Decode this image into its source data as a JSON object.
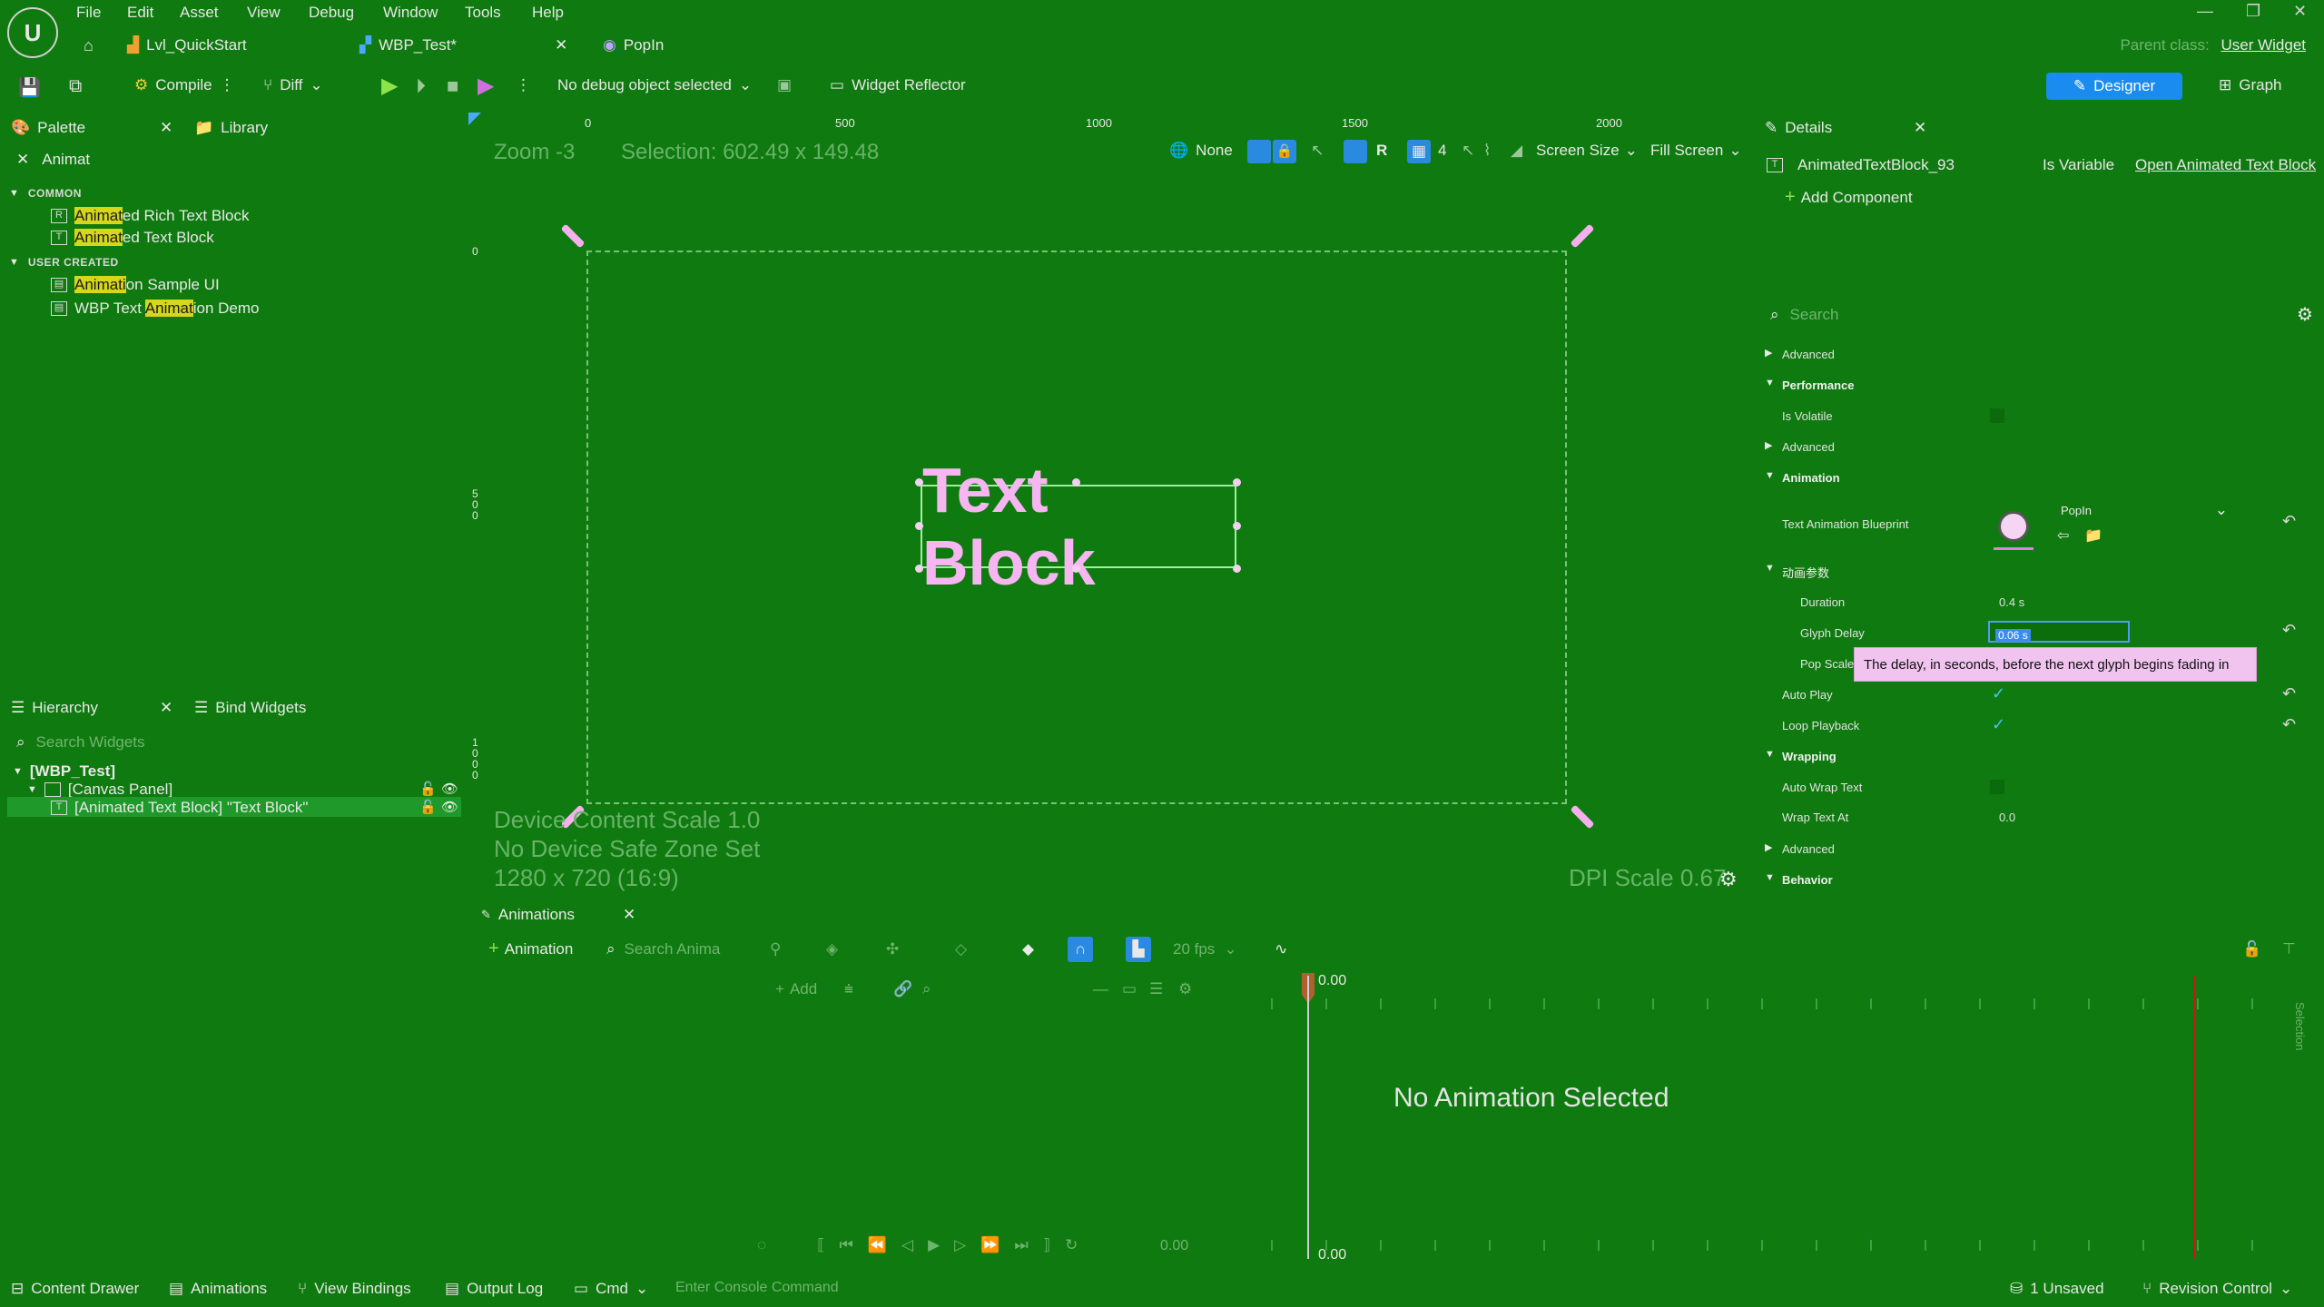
{
  "menu": [
    "File",
    "Edit",
    "Asset",
    "View",
    "Debug",
    "Window",
    "Tools",
    "Help"
  ],
  "logo": "U",
  "doc_tabs": [
    {
      "label": "Lvl_QuickStart",
      "icon": "level-icon"
    },
    {
      "label": "WBP_Test*",
      "icon": "widget-blueprint-icon"
    },
    {
      "label": "PopIn",
      "icon": "animation-blueprint-icon"
    }
  ],
  "parent_class": {
    "label": "Parent class:",
    "value": "User Widget"
  },
  "toolbar": {
    "compile": "Compile",
    "diff": "Diff",
    "debug_object": "No debug object selected",
    "widget_reflector": "Widget Reflector",
    "designer": "Designer",
    "graph": "Graph"
  },
  "palette": {
    "tab": "Palette",
    "library_tab": "Library",
    "search": "Animat",
    "categories": [
      {
        "name": "COMMON",
        "items": [
          {
            "hl": "Animat",
            "rest": "ed Rich Text Block"
          },
          {
            "hl": "Animat",
            "rest": "ed Text Block"
          }
        ]
      },
      {
        "name": "USER CREATED",
        "items": [
          {
            "pre": "",
            "hl": "Animati",
            "rest": "on Sample UI"
          },
          {
            "pre": "WBP Text ",
            "hl": "Animat",
            "rest": "ion Demo"
          }
        ]
      }
    ]
  },
  "hierarchy": {
    "tab": "Hierarchy",
    "bind_tab": "Bind Widgets",
    "search_placeholder": "Search Widgets",
    "root": "[WBP_Test]",
    "canvas": "[Canvas Panel]",
    "selected": "[Animated Text Block] \"Text Block\""
  },
  "viewport": {
    "zoom": "Zoom -3",
    "selection": "Selection: 602.49 x 149.48",
    "ruler_ticks": [
      "0",
      "500",
      "1000",
      "1500",
      "2000"
    ],
    "vruler_ticks": [
      "0",
      "5\n0\n0",
      "1\n0\n0\n0"
    ],
    "none": "None",
    "r": "R",
    "grid": "4",
    "screen_size": "Screen Size",
    "fill_screen": "Fill Screen",
    "text_block": "Text Block",
    "device_scale": "Device Content Scale 1.0",
    "safe_zone": "No Device Safe Zone Set",
    "resolution": "1280 x 720 (16:9)",
    "dpi": "DPI Scale 0.67"
  },
  "details": {
    "tab": "Details",
    "component_name": "AnimatedTextBlock_93",
    "is_variable": "Is Variable",
    "open_link": "Open Animated Text Block",
    "add_component": "Add Component",
    "search_placeholder": "Search",
    "rows": {
      "advanced1": "Advanced",
      "performance": "Performance",
      "is_volatile": "Is Volatile",
      "advanced2": "Advanced",
      "animation": "Animation",
      "text_anim_bp": "Text Animation Blueprint",
      "text_anim_bp_value": "PopIn",
      "anim_params": "动画参数",
      "duration": "Duration",
      "duration_value": "0.4 s",
      "glyph_delay": "Glyph Delay",
      "glyph_delay_value": "0.06 s",
      "pop_scale": "Pop Scale",
      "auto_play": "Auto Play",
      "loop_playback": "Loop Playback",
      "wrapping": "Wrapping",
      "auto_wrap": "Auto Wrap Text",
      "wrap_at": "Wrap Text At",
      "wrap_at_value": "0.0",
      "advanced3": "Advanced",
      "behavior": "Behavior"
    },
    "tooltip": "The delay, in seconds, before the next glyph begins fading in"
  },
  "animations": {
    "tab": "Animations",
    "add_animation": "Animation",
    "search_placeholder": "Search Anima",
    "fps": "20 fps",
    "add": "Add",
    "time_top": "0.00",
    "time_bottom": "0.00",
    "time_field": "0.00",
    "empty": "No Animation Selected",
    "selection_side": "Selection"
  },
  "statusbar": {
    "content_drawer": "Content Drawer",
    "animations": "Animations",
    "view_bindings": "View Bindings",
    "output_log": "Output Log",
    "cmd": "Cmd",
    "console_placeholder": "Enter Console Command",
    "unsaved": "1 Unsaved",
    "revision": "Revision Control"
  }
}
